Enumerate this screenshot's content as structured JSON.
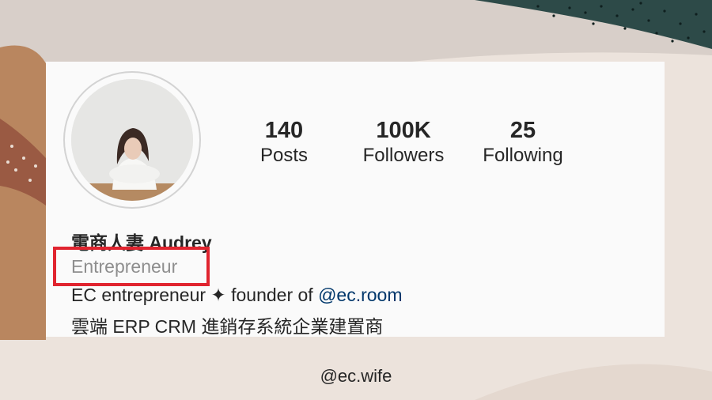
{
  "profile": {
    "stats": [
      {
        "value": "140",
        "label": "Posts"
      },
      {
        "value": "100K",
        "label": "Followers"
      },
      {
        "value": "25",
        "label": "Following"
      }
    ],
    "name": "電商人妻 Audrey",
    "category": "Entrepreneur",
    "bio_line1_prefix": "EC entrepreneur ✦ founder of ",
    "bio_line1_link": "@ec.room",
    "bio_line2": "雲端 ERP CRM 進銷存系統企業建置商"
  },
  "footer": {
    "handle": "@ec.wife"
  },
  "colors": {
    "highlight_box": "#e0242f",
    "link": "#00376b",
    "category_text": "#8e8e8e"
  }
}
